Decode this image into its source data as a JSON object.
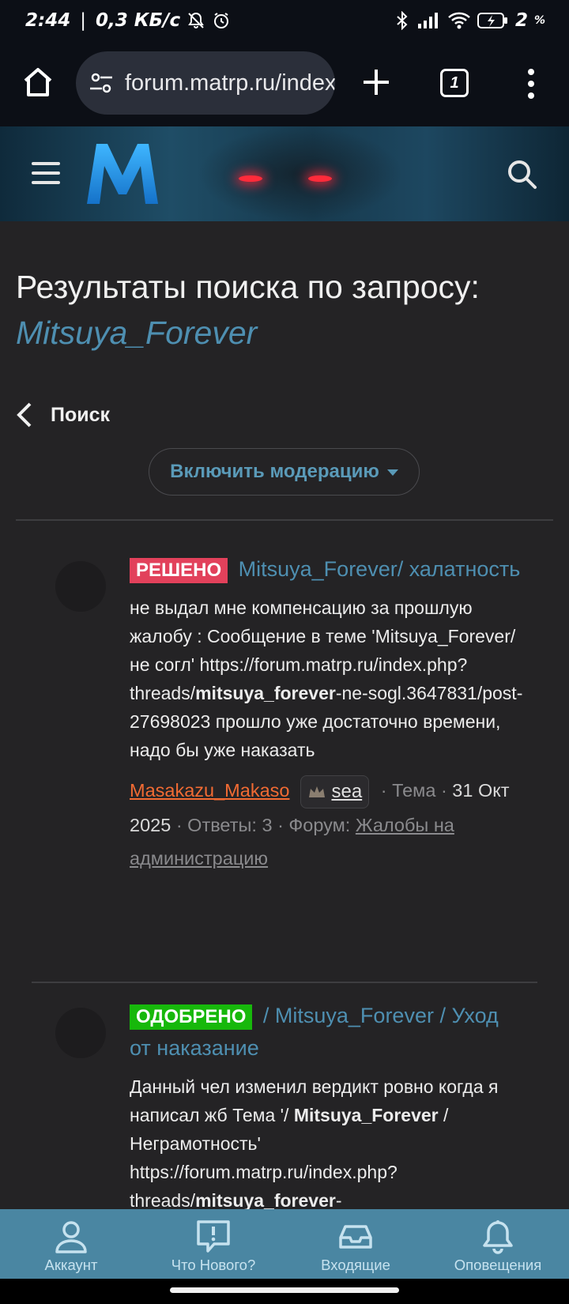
{
  "status_bar": {
    "time": "2:44",
    "speed": "0,3 КБ/с",
    "battery": "2"
  },
  "browser": {
    "url": "forum.matrp.ru/index.php?search",
    "tab_count": "1"
  },
  "page": {
    "title_prefix": "Результаты поиска по запросу:",
    "query": "Mitsuya_Forever",
    "back_label": "Поиск",
    "moderation_label": "Включить модерацию"
  },
  "results": [
    {
      "badge": "РЕШЕНО",
      "title": " Mitsuya_Forever/ халатность",
      "snippet_1": "не выдал мне компенсацию за прошлую жалобу : Сообщение в теме 'Mitsuya_Forever/не согл' https://forum.matrp.ru/index.php?threads/",
      "snippet_bold_1": "mitsuya_forever",
      "snippet_2": "-ne-sogl.3647831/post-27698023 прошло уже достаточно времени, надо бы уже наказать",
      "author": "Masakazu_Makaso",
      "tag": "sea",
      "type": "Тема",
      "date": "31 Окт 2025",
      "replies_label": "Ответы:",
      "replies": "3",
      "forum_label": "Форум:",
      "forum": "Жалобы на администрацию"
    },
    {
      "badge": "ОДОБРЕНО",
      "title": " / Mitsuya_Forever / Уход от наказание",
      "snippet_1": "Данный чел изменил вердикт ровно когда я написал жб Тема '/ ",
      "snippet_bold_1": "Mitsuya_Forever",
      "snippet_2": " / Неграмотность' https://forum.matrp.ru/index.php?threads/",
      "snippet_bold_2": "mitsuya_forever",
      "snippet_3": "-"
    }
  ],
  "bottom_nav": [
    {
      "label": "Аккаунт",
      "icon": "account-icon"
    },
    {
      "label": "Что Нового?",
      "icon": "whats-new-icon"
    },
    {
      "label": "Входящие",
      "icon": "inbox-icon"
    },
    {
      "label": "Оповещения",
      "icon": "bell-icon"
    }
  ],
  "colors": {
    "accent": "#4e8fb1",
    "badge_solved": "#e2415b",
    "badge_approved": "#17b80b",
    "author": "#f26b33",
    "nav_bg": "#4a86a2"
  }
}
